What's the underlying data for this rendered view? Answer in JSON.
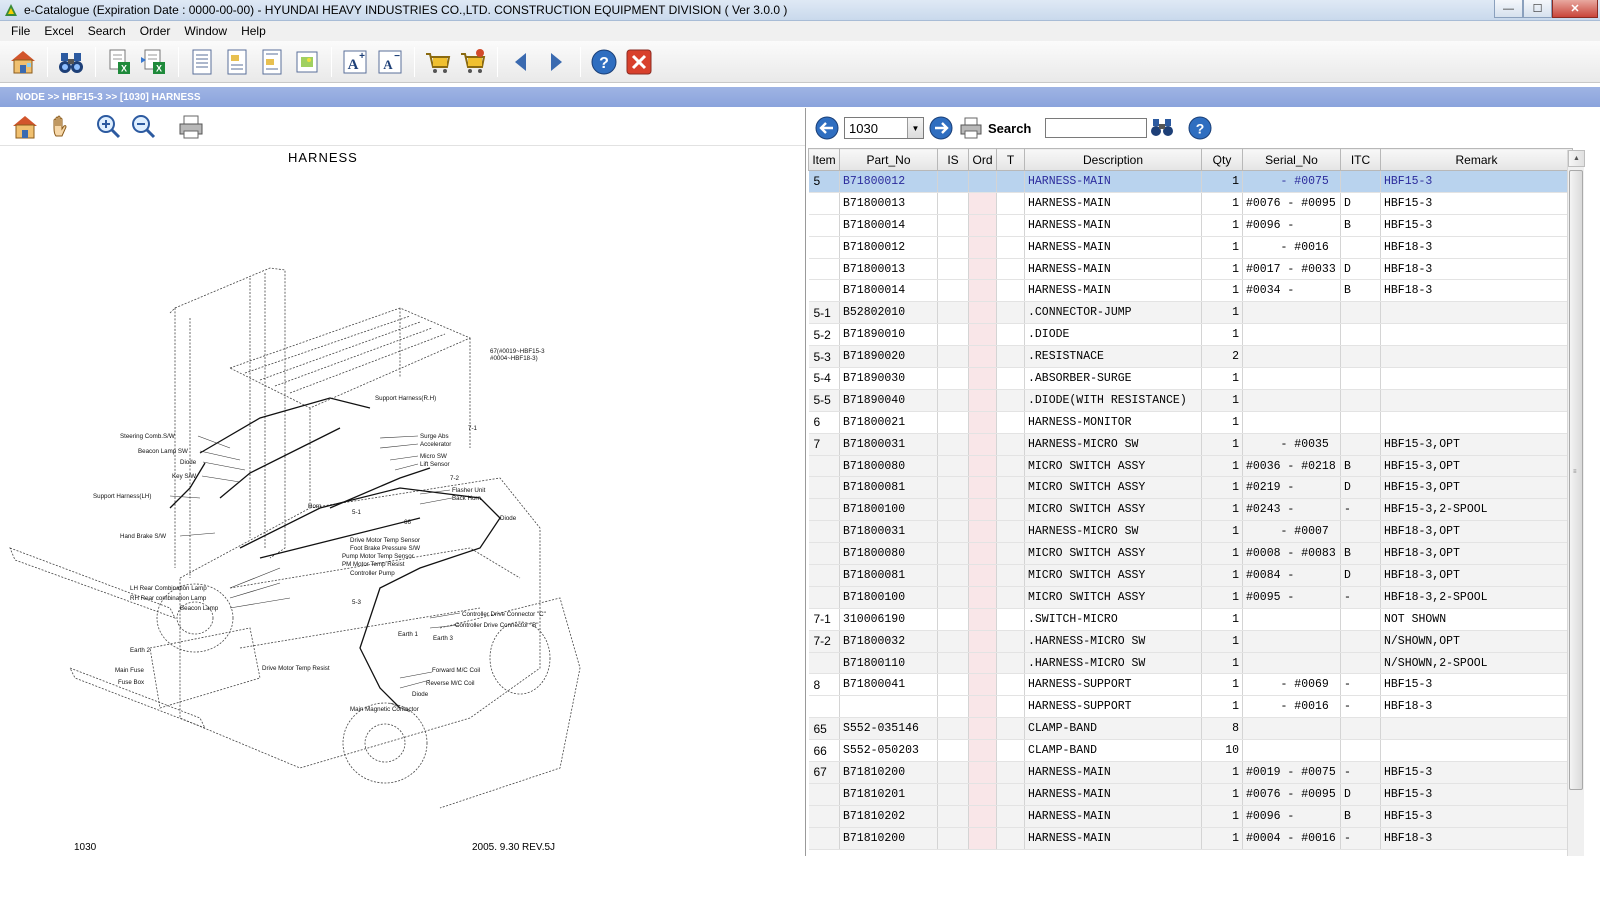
{
  "window": {
    "title": "e-Catalogue (Expiration Date : 0000-00-00)  -  HYUNDAI HEAVY INDUSTRIES CO.,LTD. CONSTRUCTION EQUIPMENT DIVISION ( Ver 3.0.0 )",
    "minimize": "—",
    "maximize": "☐",
    "close": "✕"
  },
  "menu": [
    "File",
    "Excel",
    "Search",
    "Order",
    "Window",
    "Help"
  ],
  "breadcrumb": "NODE >> HBF15-3 >> [1030] HARNESS",
  "drawing": {
    "title": "HARNESS",
    "page_number": "1030",
    "revision": "2005. 9.30 REV.5J",
    "labels": {
      "l1": "67(#0019~HBF15-3\n#0004~HBF18-3)",
      "l2": "Support Harness(R.H)",
      "l3": "Steering Comb.S/W",
      "l4": "Surge Abs",
      "l5": "Accelerator",
      "l6": "Beacon Lamp SW",
      "l7": "Diode",
      "l8": "Micro SW",
      "l9": "Lift Sensor",
      "l10": "Key S/W",
      "l11": "Flasher Unit",
      "l12": "Back Horn",
      "l13": "Support Harness(LH)",
      "l14": "Hand Brake S/W",
      "l15": "Drive Motor Temp Sensor",
      "l16": "Foot Brake Pressure S/W",
      "l17": "Pump Motor Temp Sensor",
      "l18": "PM Motor Temp Resist",
      "l19": "Controller Pump",
      "l20": "LH Rear Combination Lamp",
      "l21": "RH Rear combination Lamp",
      "l22": "Beacon Lamp",
      "l23": "Controller Drive Connector \"C\"",
      "l24": "Controller Drive Connector \"B\"",
      "l25": "Earth 1",
      "l26": "Earth 3",
      "l27": "Earth 2",
      "l28": "Main Fuse",
      "l29": "Fuse Box",
      "l30": "Drive Motor Temp Resist",
      "l31": "Forward M/C Coil",
      "l32": "Reverse M/C Coil",
      "l33": "Diode",
      "l34": "Main Magnetic Contactor",
      "l35": "Horn",
      "l36": "Diode",
      "c1": "7-1",
      "c2": "7-2",
      "c3": "66",
      "c4": "5-1",
      "c5": "5-3"
    }
  },
  "parts_toolbar": {
    "page_combo_value": "1030",
    "search_label": "Search",
    "search_value": ""
  },
  "columns": [
    "Item",
    "Part_No",
    "IS",
    "Ord",
    "T",
    "Description",
    "Qty",
    "Serial_No",
    "ITC",
    "Remark"
  ],
  "rows": [
    {
      "item": "5",
      "part": "B71800012",
      "is": "",
      "ord": "",
      "t": "",
      "desc": "HARNESS-MAIN",
      "qty": "1",
      "serial": "     - #0075",
      "itc": "",
      "remark": "HBF15-3"
    },
    {
      "item": "",
      "part": "B71800013",
      "is": "",
      "ord": "",
      "t": "",
      "desc": "HARNESS-MAIN",
      "qty": "1",
      "serial": "#0076 - #0095",
      "itc": "D",
      "remark": "HBF15-3"
    },
    {
      "item": "",
      "part": "B71800014",
      "is": "",
      "ord": "",
      "t": "",
      "desc": "HARNESS-MAIN",
      "qty": "1",
      "serial": "#0096 -",
      "itc": "B",
      "remark": "HBF15-3"
    },
    {
      "item": "",
      "part": "B71800012",
      "is": "",
      "ord": "",
      "t": "",
      "desc": "HARNESS-MAIN",
      "qty": "1",
      "serial": "     - #0016",
      "itc": "",
      "remark": "HBF18-3"
    },
    {
      "item": "",
      "part": "B71800013",
      "is": "",
      "ord": "",
      "t": "",
      "desc": "HARNESS-MAIN",
      "qty": "1",
      "serial": "#0017 - #0033",
      "itc": "D",
      "remark": "HBF18-3"
    },
    {
      "item": "",
      "part": "B71800014",
      "is": "",
      "ord": "",
      "t": "",
      "desc": "HARNESS-MAIN",
      "qty": "1",
      "serial": "#0034 -",
      "itc": "B",
      "remark": "HBF18-3"
    },
    {
      "item": "5-1",
      "part": "B52802010",
      "is": "",
      "ord": "",
      "t": "",
      "desc": ".CONNECTOR-JUMP",
      "qty": "1",
      "serial": "",
      "itc": "",
      "remark": ""
    },
    {
      "item": "5-2",
      "part": "B71890010",
      "is": "",
      "ord": "",
      "t": "",
      "desc": ".DIODE",
      "qty": "1",
      "serial": "",
      "itc": "",
      "remark": ""
    },
    {
      "item": "5-3",
      "part": "B71890020",
      "is": "",
      "ord": "",
      "t": "",
      "desc": ".RESISTNACE",
      "qty": "2",
      "serial": "",
      "itc": "",
      "remark": ""
    },
    {
      "item": "5-4",
      "part": "B71890030",
      "is": "",
      "ord": "",
      "t": "",
      "desc": ".ABSORBER-SURGE",
      "qty": "1",
      "serial": "",
      "itc": "",
      "remark": ""
    },
    {
      "item": "5-5",
      "part": "B71890040",
      "is": "",
      "ord": "",
      "t": "",
      "desc": ".DIODE(WITH RESISTANCE)",
      "qty": "1",
      "serial": "",
      "itc": "",
      "remark": ""
    },
    {
      "item": "6",
      "part": "B71800021",
      "is": "",
      "ord": "",
      "t": "",
      "desc": "HARNESS-MONITOR",
      "qty": "1",
      "serial": "",
      "itc": "",
      "remark": ""
    },
    {
      "item": "7",
      "part": "B71800031",
      "is": "",
      "ord": "",
      "t": "",
      "desc": "HARNESS-MICRO SW",
      "qty": "1",
      "serial": "     - #0035",
      "itc": "",
      "remark": "HBF15-3,OPT"
    },
    {
      "item": "",
      "part": "B71800080",
      "is": "",
      "ord": "",
      "t": "",
      "desc": "MICRO SWITCH ASSY",
      "qty": "1",
      "serial": "#0036 - #0218",
      "itc": "B",
      "remark": "HBF15-3,OPT"
    },
    {
      "item": "",
      "part": "B71800081",
      "is": "",
      "ord": "",
      "t": "",
      "desc": "MICRO SWITCH ASSY",
      "qty": "1",
      "serial": "#0219 -",
      "itc": "D",
      "remark": "HBF15-3,OPT"
    },
    {
      "item": "",
      "part": "B71800100",
      "is": "",
      "ord": "",
      "t": "",
      "desc": "MICRO SWITCH ASSY",
      "qty": "1",
      "serial": "#0243 -",
      "itc": "-",
      "remark": "HBF15-3,2-SPOOL"
    },
    {
      "item": "",
      "part": "B71800031",
      "is": "",
      "ord": "",
      "t": "",
      "desc": "HARNESS-MICRO SW",
      "qty": "1",
      "serial": "     - #0007",
      "itc": "",
      "remark": "HBF18-3,OPT"
    },
    {
      "item": "",
      "part": "B71800080",
      "is": "",
      "ord": "",
      "t": "",
      "desc": "MICRO SWITCH ASSY",
      "qty": "1",
      "serial": "#0008 - #0083",
      "itc": "B",
      "remark": "HBF18-3,OPT"
    },
    {
      "item": "",
      "part": "B71800081",
      "is": "",
      "ord": "",
      "t": "",
      "desc": "MICRO SWITCH ASSY",
      "qty": "1",
      "serial": "#0084 -",
      "itc": "D",
      "remark": "HBF18-3,OPT"
    },
    {
      "item": "",
      "part": "B71800100",
      "is": "",
      "ord": "",
      "t": "",
      "desc": "MICRO SWITCH ASSY",
      "qty": "1",
      "serial": "#0095 -",
      "itc": "-",
      "remark": "HBF18-3,2-SPOOL"
    },
    {
      "item": "7-1",
      "part": "310006190",
      "is": "",
      "ord": "",
      "t": "",
      "desc": ".SWITCH-MICRO",
      "qty": "1",
      "serial": "",
      "itc": "",
      "remark": "NOT SHOWN"
    },
    {
      "item": "7-2",
      "part": "B71800032",
      "is": "",
      "ord": "",
      "t": "",
      "desc": ".HARNESS-MICRO SW",
      "qty": "1",
      "serial": "",
      "itc": "",
      "remark": "N/SHOWN,OPT"
    },
    {
      "item": "",
      "part": "B71800110",
      "is": "",
      "ord": "",
      "t": "",
      "desc": ".HARNESS-MICRO SW",
      "qty": "1",
      "serial": "",
      "itc": "",
      "remark": "N/SHOWN,2-SPOOL"
    },
    {
      "item": "8",
      "part": "B71800041",
      "is": "",
      "ord": "",
      "t": "",
      "desc": "HARNESS-SUPPORT",
      "qty": "1",
      "serial": "     - #0069",
      "itc": "-",
      "remark": "HBF15-3"
    },
    {
      "item": "",
      "part": "",
      "is": "",
      "ord": "",
      "t": "",
      "desc": "HARNESS-SUPPORT",
      "qty": "1",
      "serial": "     - #0016",
      "itc": "-",
      "remark": "HBF18-3"
    },
    {
      "item": "65",
      "part": "S552-035146",
      "is": "",
      "ord": "",
      "t": "",
      "desc": "CLAMP-BAND",
      "qty": "8",
      "serial": "",
      "itc": "",
      "remark": ""
    },
    {
      "item": "66",
      "part": "S552-050203",
      "is": "",
      "ord": "",
      "t": "",
      "desc": "CLAMP-BAND",
      "qty": "10",
      "serial": "",
      "itc": "",
      "remark": ""
    },
    {
      "item": "67",
      "part": "B71810200",
      "is": "",
      "ord": "",
      "t": "",
      "desc": "HARNESS-MAIN",
      "qty": "1",
      "serial": "#0019 - #0075",
      "itc": "-",
      "remark": "HBF15-3"
    },
    {
      "item": "",
      "part": "B71810201",
      "is": "",
      "ord": "",
      "t": "",
      "desc": "HARNESS-MAIN",
      "qty": "1",
      "serial": "#0076 - #0095",
      "itc": "D",
      "remark": "HBF15-3"
    },
    {
      "item": "",
      "part": "B71810202",
      "is": "",
      "ord": "",
      "t": "",
      "desc": "HARNESS-MAIN",
      "qty": "1",
      "serial": "#0096 -",
      "itc": "B",
      "remark": "HBF15-3"
    },
    {
      "item": "",
      "part": "B71810200",
      "is": "",
      "ord": "",
      "t": "",
      "desc": "HARNESS-MAIN",
      "qty": "1",
      "serial": "#0004 - #0016",
      "itc": "-",
      "remark": "HBF18-3"
    }
  ],
  "icons": {
    "main_toolbar": [
      "home-icon",
      "binoculars-icon",
      "excel-export-icon",
      "excel-import-icon",
      "document-list-icon",
      "document-image-icon",
      "document-image-list-icon",
      "document-picture-icon",
      "font-increase-icon",
      "font-decrease-icon",
      "cart-add-icon",
      "cart-view-icon",
      "back-arrow-icon",
      "forward-arrow-icon",
      "help-icon",
      "exit-icon"
    ],
    "drawing_toolbar": [
      "home-icon",
      "hand-pan-icon",
      "zoom-in-icon",
      "zoom-out-icon",
      "printer-icon"
    ]
  },
  "colors": {
    "breadcrumb_bg": "#8fa7de",
    "selected_row": "#b9d3ee",
    "ord_column": "#f9e6e8"
  }
}
